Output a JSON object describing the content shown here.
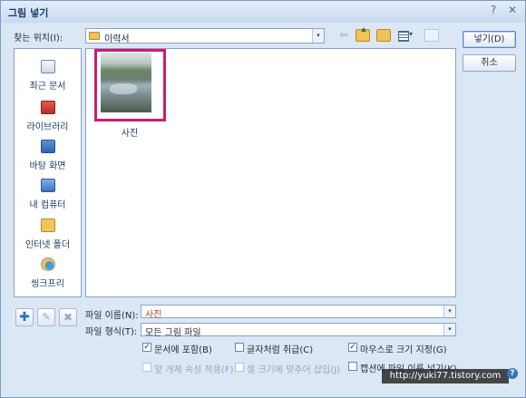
{
  "window": {
    "title": "그림 넣기",
    "help_glyph": "?",
    "close_glyph": "✕"
  },
  "lookin": {
    "label": "찾는 위치(I):",
    "value": "이력서",
    "arrow": "▾"
  },
  "toolbar": {
    "back_glyph": "⇦",
    "icons": [
      "back-icon",
      "up-folder-icon",
      "new-folder-icon",
      "views-icon",
      "delete-icon"
    ]
  },
  "buttons": {
    "insert": "넣기(D)",
    "cancel": "취소"
  },
  "places": [
    {
      "label": "최근 문서",
      "icon": "recent-documents-icon"
    },
    {
      "label": "라이브러리",
      "icon": "library-icon"
    },
    {
      "label": "바탕 화면",
      "icon": "desktop-icon"
    },
    {
      "label": "내 컴퓨터",
      "icon": "my-computer-icon"
    },
    {
      "label": "인터넷 폴더",
      "icon": "internet-folder-icon"
    },
    {
      "label": "씽크프리",
      "icon": "thinkfree-icon"
    }
  ],
  "files": [
    {
      "name": "사진",
      "selected": true
    }
  ],
  "side_tools": {
    "add": "✚",
    "edit": "✎",
    "remove": "✖"
  },
  "filename": {
    "label": "파일 이름(N):",
    "value": "사진",
    "arrow": "▾"
  },
  "filetype": {
    "label": "파일 형식(T):",
    "value": "모든 그림 파일",
    "arrow": "▾"
  },
  "options": {
    "embed": {
      "label": "문서에 포함(B)",
      "checked": true,
      "mark": "✓"
    },
    "as_char": {
      "label": "글자처럼 취급(C)",
      "checked": false,
      "mark": ""
    },
    "mouse_size": {
      "label": "마우스로 크기 지정(G)",
      "checked": true,
      "mark": "✓"
    },
    "apply_props": {
      "label": "앞 개체 속성 적용(F)",
      "checked": false,
      "mark": "",
      "disabled": true
    },
    "fit_cell": {
      "label": "셀 크기에 맞추어 삽입(J)",
      "checked": false,
      "mark": "",
      "disabled": true
    },
    "caption_name": {
      "label": "캡션에 파일 이름 넣기(K)",
      "checked": false,
      "mark": ""
    }
  },
  "watermark": "http://yuki77.tistory.com",
  "help_icon": "?",
  "colors": {
    "selection_frame": "#d11a6b",
    "dialog_bg": "#dbe7f5",
    "accent": "#3b73c4"
  }
}
